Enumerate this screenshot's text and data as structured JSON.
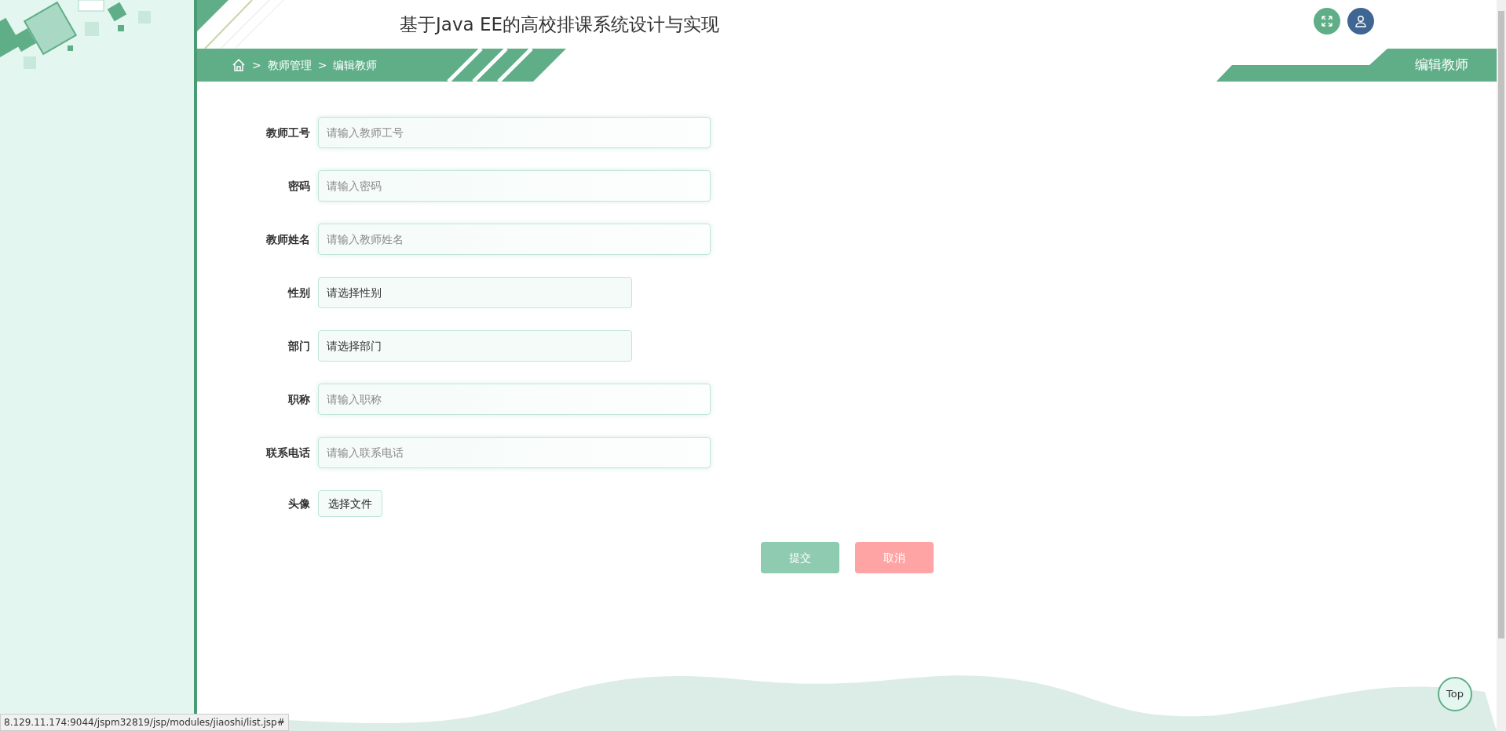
{
  "header": {
    "title": "基于Java EE的高校排课系统设计与实现"
  },
  "breadcrumb": {
    "separator": ">",
    "items": [
      "教师管理",
      "编辑教师"
    ]
  },
  "page_tag": "编辑教师",
  "form": {
    "fields": [
      {
        "kind": "text",
        "label": "教师工号",
        "placeholder": "请输入教师工号"
      },
      {
        "kind": "text",
        "label": "密码",
        "placeholder": "请输入密码"
      },
      {
        "kind": "text",
        "label": "教师姓名",
        "placeholder": "请输入教师姓名"
      },
      {
        "kind": "select",
        "label": "性别",
        "value": "请选择性别"
      },
      {
        "kind": "select",
        "label": "部门",
        "value": "请选择部门"
      },
      {
        "kind": "text",
        "label": "职称",
        "placeholder": "请输入职称"
      },
      {
        "kind": "text",
        "label": "联系电话",
        "placeholder": "请输入联系电话"
      },
      {
        "kind": "file",
        "label": "头像",
        "button": "选择文件"
      }
    ]
  },
  "buttons": [
    {
      "kind": "submit",
      "label": "提交"
    },
    {
      "kind": "cancel",
      "label": "取消"
    }
  ],
  "back_to_top": "Top",
  "status_url": "8.129.11.174:9044/jspm32819/jsp/modules/jiaoshi/list.jsp#"
}
